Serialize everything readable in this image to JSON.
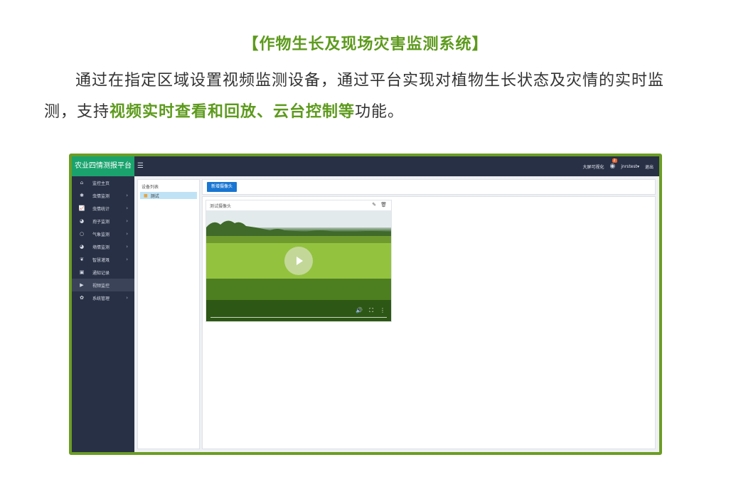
{
  "heading": "【作物生长及现场灾害监测系统】",
  "paragraph": {
    "part1": "通过在指定区域设置视频监测设备，通过平台实现对植物生长状态及灾情的实时监测，支持",
    "highlight": "视频实时查看和回放、云台控制等",
    "part2": "功能。"
  },
  "app": {
    "brand": "农业四情测报平台",
    "top_right": {
      "big_screen": "大屏可视化",
      "notification_count": "2",
      "user": "jnrstest",
      "logout": "退出"
    },
    "sidebar": [
      {
        "label": "监控主页",
        "icon": "home",
        "chevron": false,
        "active": false
      },
      {
        "label": "虫情监测",
        "icon": "bug",
        "chevron": true,
        "active": false
      },
      {
        "label": "虫情统计",
        "icon": "chart",
        "chevron": true,
        "active": false
      },
      {
        "label": "孢子监测",
        "icon": "spore",
        "chevron": true,
        "active": false
      },
      {
        "label": "气象监测",
        "icon": "circle",
        "chevron": true,
        "active": false
      },
      {
        "label": "墒情监测",
        "icon": "drop",
        "chevron": true,
        "active": false
      },
      {
        "label": "智慧灌溉",
        "icon": "leaf",
        "chevron": true,
        "active": false
      },
      {
        "label": "通知记录",
        "icon": "card",
        "chevron": false,
        "active": false
      },
      {
        "label": "视频监控",
        "icon": "video",
        "chevron": false,
        "active": true
      },
      {
        "label": "系统管理",
        "icon": "gear",
        "chevron": true,
        "active": false
      }
    ],
    "device_panel": {
      "title": "设备列表",
      "items": [
        "测试"
      ]
    },
    "toolbar": {
      "add_camera": "新增摄像头"
    },
    "camera": {
      "title": "测试摄像头"
    }
  }
}
